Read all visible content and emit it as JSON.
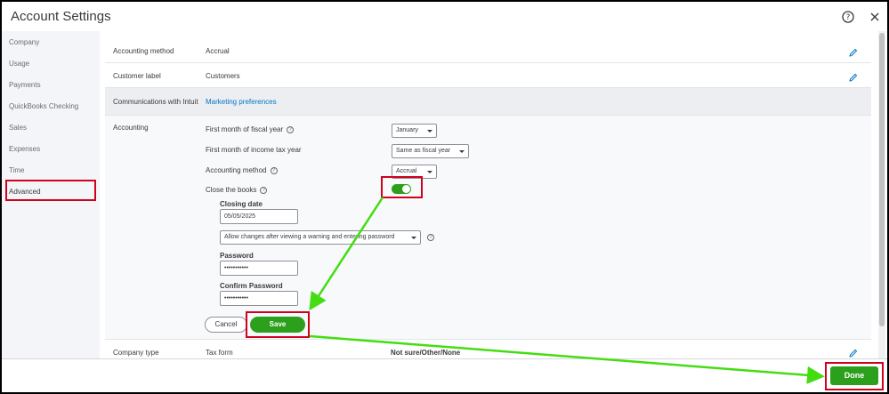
{
  "window": {
    "title": "Account Settings"
  },
  "sidebar": {
    "items": [
      {
        "label": "Company"
      },
      {
        "label": "Usage"
      },
      {
        "label": "Payments"
      },
      {
        "label": "QuickBooks Checking"
      },
      {
        "label": "Sales"
      },
      {
        "label": "Expenses"
      },
      {
        "label": "Time"
      },
      {
        "label": "Advanced"
      }
    ],
    "active": "Advanced"
  },
  "rows": {
    "accounting_method": {
      "label": "Accounting method",
      "value": "Accrual"
    },
    "customer_label": {
      "label": "Customer label",
      "value": "Customers"
    },
    "communications": {
      "label": "Communications with Intuit",
      "value": "Marketing preferences"
    },
    "company_type": {
      "label": "Company type",
      "tax_form_label": "Tax form",
      "tax_form_value": "Not sure/Other/None"
    }
  },
  "accounting": {
    "label": "Accounting",
    "fiscal_year_label": "First month of fiscal year",
    "fiscal_year_value": "January",
    "income_tax_label": "First month of income tax year",
    "income_tax_value": "Same as fiscal year",
    "method_label": "Accounting method",
    "method_value": "Accrual",
    "close_books_label": "Close the books",
    "close_books_on": true,
    "closing_date_label": "Closing date",
    "closing_date_value": "05/05/2025",
    "changes_option": "Allow changes after viewing a warning and entering password",
    "password_label": "Password",
    "password_value": "•••••••••••",
    "confirm_label": "Confirm Password",
    "confirm_value": "•••••••••••",
    "cancel_label": "Cancel",
    "save_label": "Save"
  },
  "footer": {
    "done_label": "Done"
  },
  "colors": {
    "brand_green": "#2ca01c",
    "highlight_red": "#d0021b",
    "arrow_green": "#44dd11",
    "link_blue": "#0077c5"
  }
}
